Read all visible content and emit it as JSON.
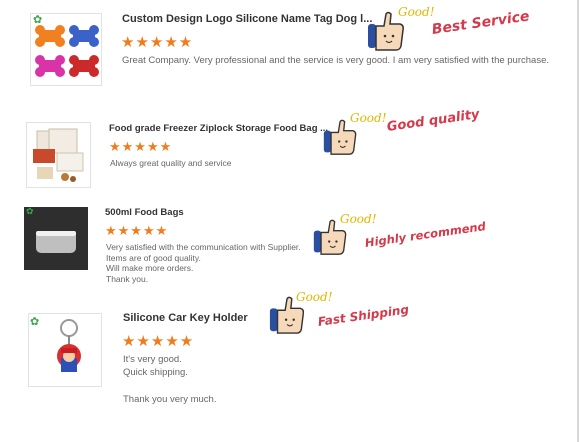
{
  "reviews": [
    {
      "title": "Custom Design Logo Silicone Name Tag Dog l...",
      "stars": "★★★★★",
      "review_lines": [
        "Great Company. Very professional and the service is very good. I am very satisfied with the purchase."
      ],
      "sticker_text": "Good!",
      "slogan": "Best Service"
    },
    {
      "title": "Food grade Freezer Ziplock Storage Food Bag ...",
      "stars": "★★★★★",
      "review_lines": [
        "Always great quality and service"
      ],
      "sticker_text": "Good!",
      "slogan": "Good quality"
    },
    {
      "title": "500ml Food Bags",
      "stars": "★★★★★",
      "review_lines": [
        "Very satisfied with the communication with Supplier.",
        "Items are of good quality.",
        "Will make more orders.",
        "Thank you."
      ],
      "sticker_text": "Good!",
      "slogan": "Highly recommend"
    },
    {
      "title": "Silicone Car Key Holder",
      "stars": "★★★★★",
      "review_lines": [
        "It's very good.",
        "Quick shipping.",
        "",
        "Thank you very much."
      ],
      "sticker_text": "Good!",
      "slogan": "Fast Shipping"
    }
  ],
  "colors": {
    "star": "#f07c1c",
    "slogan": "#d63a4a",
    "good": "#e0b800",
    "leaf": "#3aa64a"
  },
  "icons": [
    "leaf-badge-icon",
    "thumbs-up-sticker-icon",
    "star-icon"
  ]
}
